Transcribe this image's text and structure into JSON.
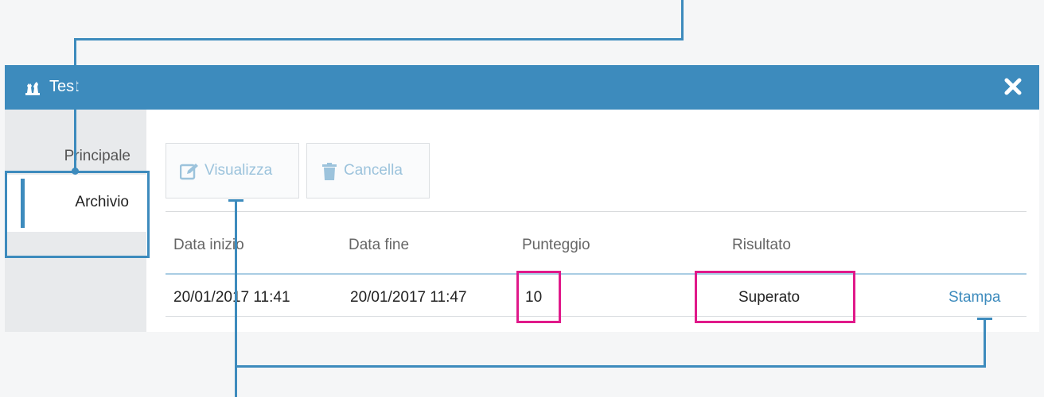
{
  "window": {
    "title": "Test",
    "title_icon": "chess-pieces-icon",
    "close_icon": "close-icon"
  },
  "sidebar": {
    "items": [
      {
        "label": "Principale"
      },
      {
        "label": "Archivio",
        "active": true
      }
    ]
  },
  "toolbar": {
    "view_label": "Visualizza",
    "view_icon": "edit-icon",
    "delete_label": "Cancella",
    "delete_icon": "trash-icon"
  },
  "table": {
    "headers": [
      "Data inizio",
      "Data fine",
      "Punteggio",
      "Risultato"
    ],
    "rows": [
      {
        "start": "20/01/2017 11:41",
        "end": "20/01/2017 11:47",
        "score": "10",
        "result": "Superato",
        "action": "Stampa"
      }
    ]
  },
  "colors": {
    "accent": "#3d8bbd",
    "highlight": "#e0198a",
    "sidebar_bg": "#e8eaec"
  }
}
